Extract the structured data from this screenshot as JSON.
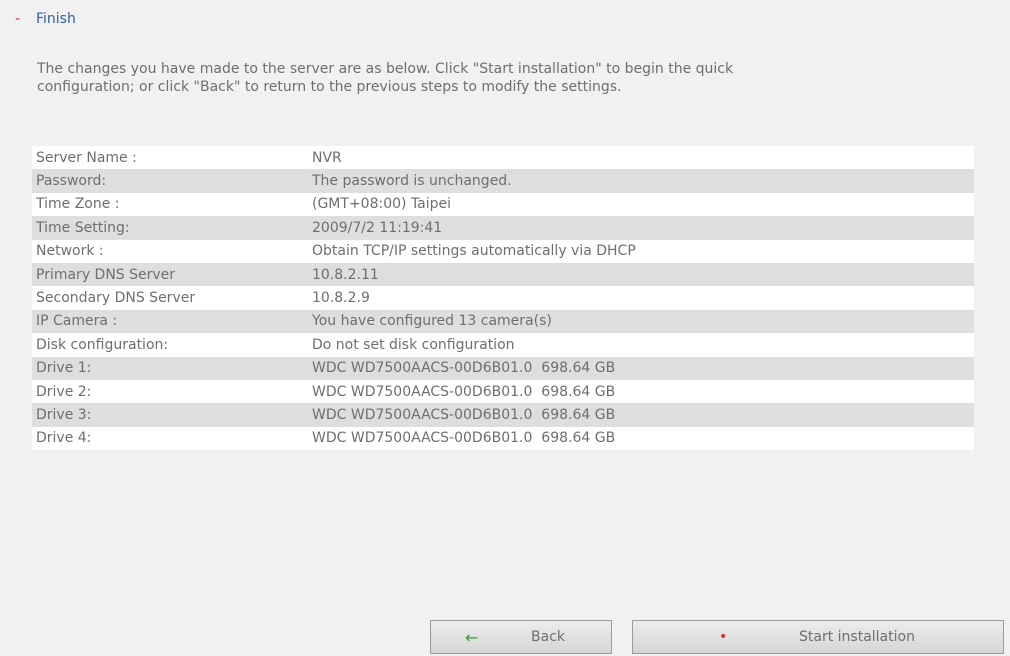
{
  "section": {
    "marker": "-",
    "title": "Finish"
  },
  "intro": {
    "line1": "The changes you have made to the server are as below. Click \"Start installation\" to begin the quick",
    "line2": "configuration; or click \"Back\" to return to the previous steps to modify the settings."
  },
  "summary": [
    {
      "label": "Server Name :",
      "value": "NVR"
    },
    {
      "label": "Password:",
      "value": "The password is unchanged."
    },
    {
      "label": "Time Zone :",
      "value": "(GMT+08:00) Taipei"
    },
    {
      "label": "Time Setting:",
      "value": "2009/7/2 11:19:41"
    },
    {
      "label": "Network :",
      "value": "Obtain TCP/IP settings automatically via DHCP"
    },
    {
      "label": "Primary DNS Server",
      "value": "10.8.2.11"
    },
    {
      "label": "Secondary DNS Server",
      "value": "10.8.2.9"
    },
    {
      "label": "IP Camera :",
      "value": "You have configured 13 camera(s)"
    },
    {
      "label": "Disk configuration:",
      "value": "Do not set disk configuration"
    },
    {
      "label": "Drive 1:",
      "value": "WDC WD7500AACS-00D6B01.0  698.64 GB"
    },
    {
      "label": "Drive 2:",
      "value": "WDC WD7500AACS-00D6B01.0  698.64 GB"
    },
    {
      "label": "Drive 3:",
      "value": "WDC WD7500AACS-00D6B01.0  698.64 GB"
    },
    {
      "label": "Drive 4:",
      "value": "WDC WD7500AACS-00D6B01.0  698.64 GB"
    }
  ],
  "buttons": {
    "back": {
      "label": "Back",
      "icon": "left-arrow-icon"
    },
    "start": {
      "label": "Start installation",
      "icon": "dot-icon"
    }
  },
  "colors": {
    "accent_title": "#2c5fa8",
    "marker_red": "#d03030",
    "arrow_green": "#2fa32f",
    "row_alt": "#dedede",
    "panel_bg": "#f1f1f1"
  }
}
